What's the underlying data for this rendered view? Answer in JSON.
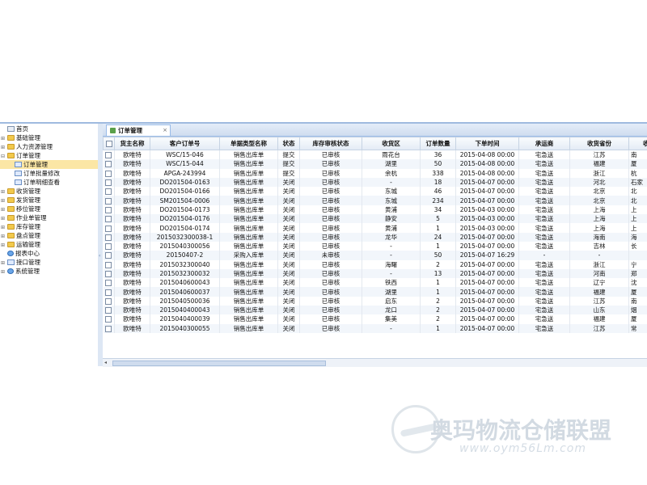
{
  "sidebar": {
    "items": [
      {
        "label": "首页",
        "exp": "",
        "icon": "home",
        "indent": 0
      },
      {
        "label": "基础管理",
        "exp": "⊞",
        "icon": "folder",
        "indent": 0
      },
      {
        "label": "人力资源管理",
        "exp": "⊞",
        "icon": "folder",
        "indent": 0
      },
      {
        "label": "订单管理",
        "exp": "⊟",
        "icon": "folder",
        "indent": 0
      },
      {
        "label": "订单管理",
        "exp": "",
        "icon": "doc",
        "indent": 1,
        "selected": true
      },
      {
        "label": "订单批量修改",
        "exp": "",
        "icon": "doc",
        "indent": 1
      },
      {
        "label": "订单明细查看",
        "exp": "",
        "icon": "doc",
        "indent": 1
      },
      {
        "label": "收货管理",
        "exp": "⊞",
        "icon": "folder",
        "indent": 0
      },
      {
        "label": "发货管理",
        "exp": "⊞",
        "icon": "folder",
        "indent": 0
      },
      {
        "label": "移位管理",
        "exp": "⊞",
        "icon": "folder",
        "indent": 0
      },
      {
        "label": "作业单管理",
        "exp": "⊞",
        "icon": "folder",
        "indent": 0
      },
      {
        "label": "库存管理",
        "exp": "⊞",
        "icon": "folder",
        "indent": 0
      },
      {
        "label": "盘点管理",
        "exp": "⊞",
        "icon": "folder",
        "indent": 0
      },
      {
        "label": "运输管理",
        "exp": "⊞",
        "icon": "folder",
        "indent": 0
      },
      {
        "label": "报表中心",
        "exp": "",
        "icon": "globe",
        "indent": 0
      },
      {
        "label": "接口管理",
        "exp": "⊞",
        "icon": "doc",
        "indent": 0
      },
      {
        "label": "系统管理",
        "exp": "⊞",
        "icon": "globe",
        "indent": 0
      }
    ]
  },
  "splitter": {
    "arrow": "‹"
  },
  "tabs": {
    "active_label": "订单管理",
    "close": "×"
  },
  "grid": {
    "columns": [
      "货主名称",
      "客户订单号",
      "单据类型名称",
      "状态",
      "库存审核状态",
      "收货区",
      "订单数量",
      "下单时间",
      "承运商",
      "收货省份",
      "收货"
    ],
    "rows": [
      [
        "欧唯特",
        "WSC/15-046",
        "销售出库单",
        "提交",
        "已审核",
        "雨花台",
        "36",
        "2015-04-08 00:00",
        "宅急送",
        "江苏",
        "南"
      ],
      [
        "欧唯特",
        "WSC/15-044",
        "销售出库单",
        "提交",
        "已审核",
        "湖里",
        "50",
        "2015-04-08 00:00",
        "宅急送",
        "福建",
        "厦"
      ],
      [
        "欧唯特",
        "APGA-243994",
        "销售出库单",
        "提交",
        "已审核",
        "余杭",
        "338",
        "2015-04-08 00:00",
        "宅急送",
        "浙江",
        "杭"
      ],
      [
        "欧唯特",
        "DO201504-0163",
        "销售出库单",
        "关闭",
        "已审核",
        "-",
        "18",
        "2015-04-07 00:00",
        "宅急送",
        "河北",
        "石家"
      ],
      [
        "欧唯特",
        "DO201504-0166",
        "销售出库单",
        "关闭",
        "已审核",
        "东城",
        "46",
        "2015-04-07 00:00",
        "宅急送",
        "北京",
        "北"
      ],
      [
        "欧唯特",
        "SM201504-0006",
        "销售出库单",
        "关闭",
        "已审核",
        "东城",
        "234",
        "2015-04-07 00:00",
        "宅急送",
        "北京",
        "北"
      ],
      [
        "欧唯特",
        "DO201504-0173",
        "销售出库单",
        "关闭",
        "已审核",
        "黄浦",
        "34",
        "2015-04-03 00:00",
        "宅急送",
        "上海",
        "上"
      ],
      [
        "欧唯特",
        "DO201504-0176",
        "销售出库单",
        "关闭",
        "已审核",
        "静安",
        "5",
        "2015-04-03 00:00",
        "宅急送",
        "上海",
        "上"
      ],
      [
        "欧唯特",
        "DO201504-0174",
        "销售出库单",
        "关闭",
        "已审核",
        "黄浦",
        "1",
        "2015-04-03 00:00",
        "宅急送",
        "上海",
        "上"
      ],
      [
        "欧唯特",
        "2015032300038-1",
        "销售出库单",
        "关闭",
        "已审核",
        "龙华",
        "24",
        "2015-04-07 00:00",
        "宅急送",
        "海南",
        "海"
      ],
      [
        "欧唯特",
        "2015040300056",
        "销售出库单",
        "关闭",
        "已审核",
        "-",
        "1",
        "2015-04-07 00:00",
        "宅急送",
        "吉林",
        "长"
      ],
      [
        "欧唯特",
        "20150407-2",
        "采购入库单",
        "关闭",
        "未审核",
        "-",
        "50",
        "2015-04-07 16:29",
        "-",
        "-",
        ""
      ],
      [
        "欧唯特",
        "2015032300040",
        "销售出库单",
        "关闭",
        "已审核",
        "海曙",
        "2",
        "2015-04-07 00:00",
        "宅急送",
        "浙江",
        "宁"
      ],
      [
        "欧唯特",
        "2015032300032",
        "销售出库单",
        "关闭",
        "已审核",
        "-",
        "13",
        "2015-04-07 00:00",
        "宅急送",
        "河南",
        "郑"
      ],
      [
        "欧唯特",
        "2015040600043",
        "销售出库单",
        "关闭",
        "已审核",
        "铁西",
        "1",
        "2015-04-07 00:00",
        "宅急送",
        "辽宁",
        "沈"
      ],
      [
        "欧唯特",
        "2015040600037",
        "销售出库单",
        "关闭",
        "已审核",
        "湖里",
        "1",
        "2015-04-07 00:00",
        "宅急送",
        "福建",
        "厦"
      ],
      [
        "欧唯特",
        "2015040500036",
        "销售出库单",
        "关闭",
        "已审核",
        "启东",
        "2",
        "2015-04-07 00:00",
        "宅急送",
        "江苏",
        "南"
      ],
      [
        "欧唯特",
        "2015040400043",
        "销售出库单",
        "关闭",
        "已审核",
        "龙口",
        "2",
        "2015-04-07 00:00",
        "宅急送",
        "山东",
        "烟"
      ],
      [
        "欧唯特",
        "2015040400039",
        "销售出库单",
        "关闭",
        "已审核",
        "集美",
        "2",
        "2015-04-07 00:00",
        "宅急送",
        "福建",
        "厦"
      ],
      [
        "欧唯特",
        "2015040300055",
        "销售出库单",
        "关闭",
        "已审核",
        "-",
        "1",
        "2015-04-07 00:00",
        "宅急送",
        "江苏",
        "常"
      ]
    ]
  },
  "scrollbar": {
    "left_arrow": "◂"
  },
  "watermark": {
    "title": "奥玛物流仓储联盟",
    "url": "www.oym56Lm.com"
  }
}
